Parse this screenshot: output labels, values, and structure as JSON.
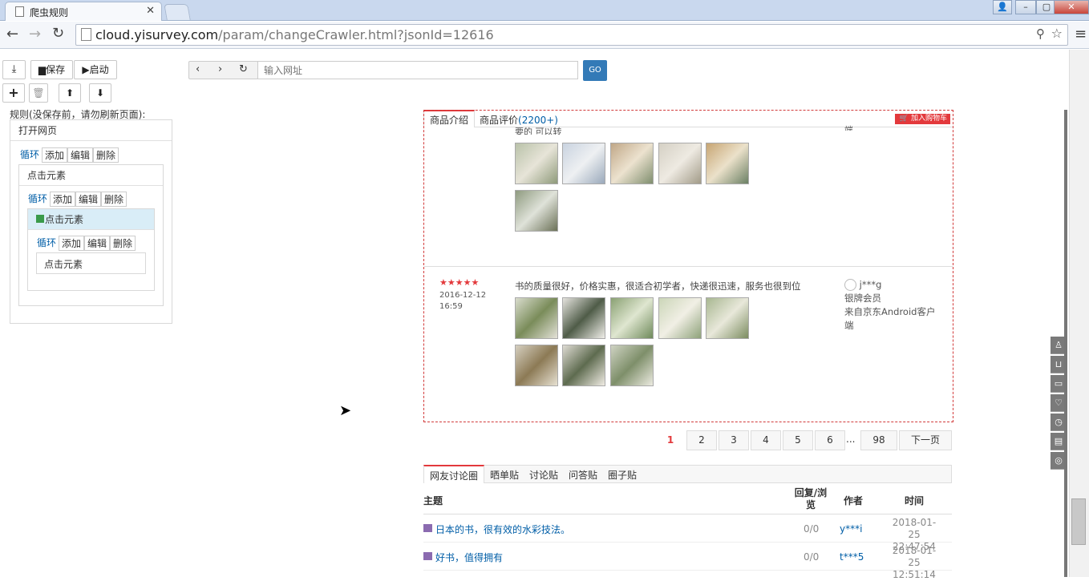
{
  "browser": {
    "tab_title": "爬虫规则",
    "url_host": "cloud.yisurvey.com",
    "url_path": "/param/changeCrawler.html?jsonId=12616",
    "minimize": "–",
    "maximize": "▢",
    "close": "✕"
  },
  "toolbar": {
    "save_label": "保存",
    "start_label": "启动",
    "url_placeholder": "输入网址",
    "go_label": "GO"
  },
  "rules": {
    "title": "规则(没保存前，请勿刷新页面):",
    "open_page": "打开网页",
    "tabs": [
      "循环",
      "添加",
      "编辑",
      "删除"
    ],
    "click_element": "点击元素"
  },
  "product_tabs": {
    "intro": "商品介绍",
    "reviews": "商品评价",
    "review_count": "(2200+)",
    "add_cart": "加入购物车"
  },
  "reviews": [
    {
      "text_partial": "要的 可以转"
    },
    {
      "stars": 5,
      "date": "2016-12-12",
      "time": "16:59",
      "text": "书的质量很好，价格实惠，很适合初学者，快递很迅速，服务也很到位",
      "user": "j***g",
      "level": "银牌会员",
      "source": "来自京东Android客户端"
    }
  ],
  "pagination": {
    "current": "1",
    "pages": [
      "2",
      "3",
      "4",
      "5",
      "6"
    ],
    "ellipsis": "...",
    "last": "98",
    "next": "下一页"
  },
  "forum": {
    "tabs": [
      "网友讨论圈",
      "晒单贴",
      "讨论贴",
      "问答贴",
      "圈子贴"
    ],
    "headers": {
      "topic": "主题",
      "replies": "回复/浏览",
      "author": "作者",
      "time": "时间"
    },
    "rows": [
      {
        "topic": "日本的书，很有效的水彩技法。",
        "replies": "0/0",
        "author": "y***i",
        "date": "2018-01-25",
        "time": "22:47:54"
      },
      {
        "topic": "好书，值得拥有",
        "replies": "0/0",
        "author": "t***5",
        "date": "2018-01-25",
        "time": "12:51:14"
      }
    ]
  },
  "colors": {
    "accent": "#e3393c",
    "link": "#005ea7",
    "go_button": "#337ab7"
  }
}
